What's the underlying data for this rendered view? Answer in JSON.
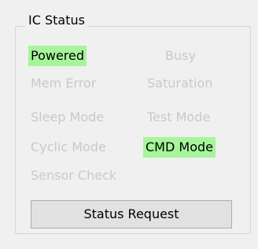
{
  "group": {
    "title": "IC Status"
  },
  "status_items": [
    {
      "label": "Powered",
      "active": true
    },
    {
      "label": "Busy",
      "active": false
    },
    {
      "label": "Mem Error",
      "active": false
    },
    {
      "label": "Saturation",
      "active": false
    },
    {
      "label": "Sleep Mode",
      "active": false
    },
    {
      "label": "Test Mode",
      "active": false
    },
    {
      "label": "Cyclic Mode",
      "active": false
    },
    {
      "label": "CMD Mode",
      "active": true
    },
    {
      "label": "Sensor Check",
      "active": false
    }
  ],
  "buttons": {
    "status_request": "Status Request"
  },
  "colors": {
    "background": "#f0f0f0",
    "active_highlight": "#a6f59a",
    "inactive_text": "#c9c9c9",
    "active_text": "#000000"
  }
}
